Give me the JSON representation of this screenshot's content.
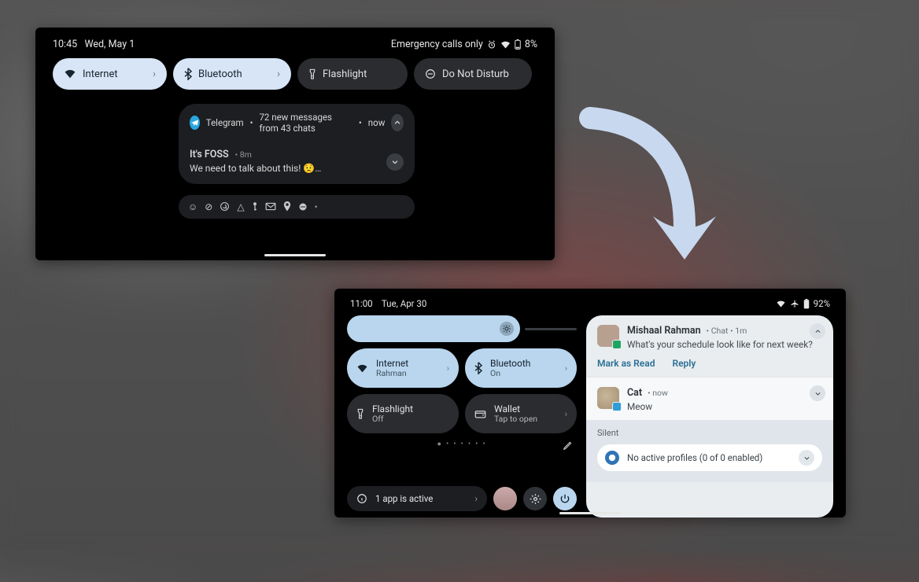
{
  "panel1": {
    "status": {
      "time": "10:45",
      "date": "Wed, May 1",
      "right_text": "Emergency calls only",
      "battery": "8%"
    },
    "chips": [
      {
        "icon": "wifi-icon",
        "label": "Internet",
        "active": true
      },
      {
        "icon": "bluetooth-icon",
        "label": "Bluetooth",
        "active": true
      },
      {
        "icon": "flashlight-icon",
        "label": "Flashlight",
        "active": false
      },
      {
        "icon": "dnd-icon",
        "label": "Do Not Disturb",
        "active": false
      }
    ],
    "group": {
      "app": "Telegram",
      "summary": "72 new messages from 43 chats",
      "when": "now"
    },
    "message": {
      "title": "It's FOSS",
      "time": "8m",
      "body": "We need to talk about this! 😟…"
    }
  },
  "panel2": {
    "status": {
      "time": "11:00",
      "date": "Tue, Apr 30",
      "battery": "92%"
    },
    "tiles": [
      {
        "icon": "wifi-icon",
        "label": "Internet",
        "sub": "Rahman",
        "active": true
      },
      {
        "icon": "bluetooth-icon",
        "label": "Bluetooth",
        "sub": "On",
        "active": true
      },
      {
        "icon": "flashlight-icon",
        "label": "Flashlight",
        "sub": "Off",
        "active": false
      },
      {
        "icon": "wallet-icon",
        "label": "Wallet",
        "sub": "Tap to open",
        "active": false
      }
    ],
    "active_apps": "1 app is active",
    "notifs": [
      {
        "name": "Mishaal Rahman",
        "meta": "Chat • 1m",
        "body": "What's your schedule look like for next week?",
        "actions": [
          "Mark as Read",
          "Reply"
        ]
      },
      {
        "name": "Cat",
        "meta": "now",
        "body": "Meow"
      }
    ],
    "silent_label": "Silent",
    "profiles": "No active profiles (0 of 0 enabled)"
  }
}
